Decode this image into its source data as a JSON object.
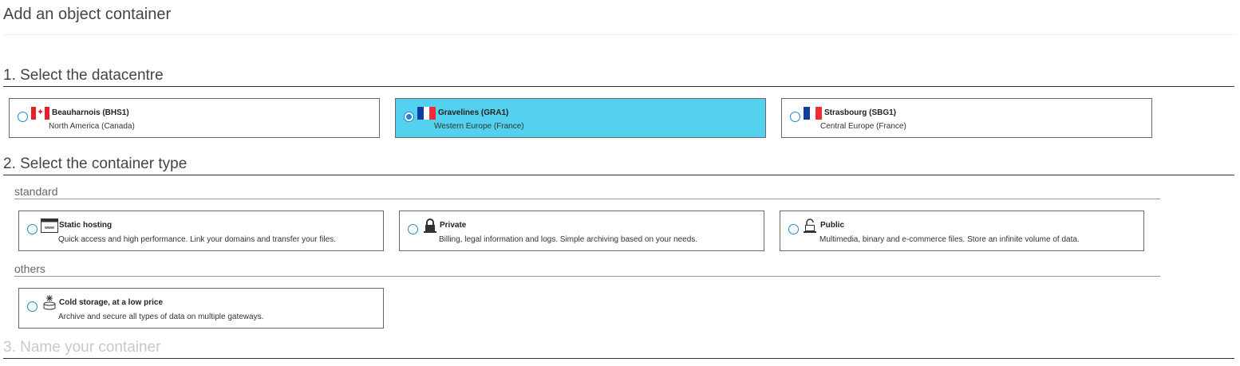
{
  "page": {
    "title": "Add an object container"
  },
  "sections": [
    {
      "title": "1. Select the datacentre"
    },
    {
      "title": "2. Select the container type"
    },
    {
      "title": "3. Name your container"
    }
  ],
  "datacentres": [
    {
      "name": "Beauharnois (BHS1)",
      "region": "North America (Canada)",
      "flag": "canada-flag",
      "selected": false
    },
    {
      "name": "Gravelines (GRA1)",
      "region": "Western Europe (France)",
      "flag": "france-flag",
      "selected": true
    },
    {
      "name": "Strasbourg (SBG1)",
      "region": "Central Europe (France)",
      "flag": "france-flag",
      "selected": false
    }
  ],
  "container_groups": {
    "standard": {
      "label": "standard",
      "items": [
        {
          "name": "Static hosting",
          "description": "Quick access and high performance. Link your domains and transfer your files.",
          "icon": "www-browser-icon"
        },
        {
          "name": "Private",
          "description": "Billing, legal information and logs. Simple archiving based on your needs.",
          "icon": "padlock-locked-icon"
        },
        {
          "name": "Public",
          "description": "Multimedia, binary and e-commerce files. Store an infinite volume of data.",
          "icon": "padlock-unlocked-icon"
        }
      ]
    },
    "others": {
      "label": "others",
      "items": [
        {
          "name": "Cold storage, at a low price",
          "description": "Archive and secure all types of data on multiple gateways.",
          "icon": "cold-storage-icon"
        }
      ]
    }
  },
  "colors": {
    "selected_card": "#53d1ee",
    "radio": "#1f86c8",
    "flag_red": "#e4202b",
    "flag_blue": "#0d3d9e"
  }
}
